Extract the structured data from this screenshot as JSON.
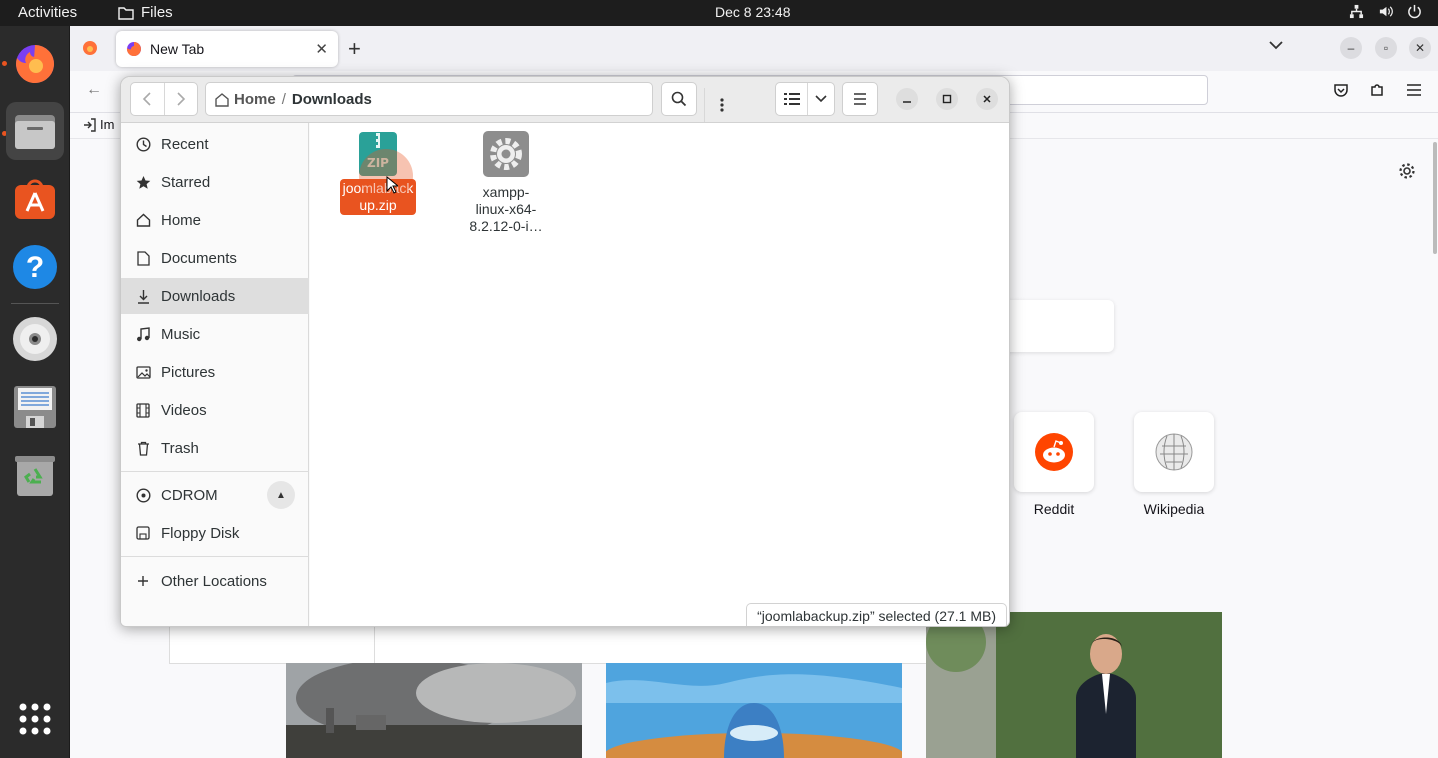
{
  "topbar": {
    "activities": "Activities",
    "app_name": "Files",
    "clock": "Dec 8  23:48"
  },
  "dock": {
    "items": [
      "firefox-icon",
      "files-icon",
      "app-center-icon",
      "help-icon",
      "cdrom-icon",
      "floppy-disk-icon",
      "trash-icon",
      "show-apps-icon"
    ]
  },
  "firefox": {
    "tab_title": "New Tab",
    "bookmark_label": "Im",
    "shortcuts": [
      {
        "label": "Reddit",
        "color": "#ff4500"
      },
      {
        "label": "Wikipedia",
        "color": "#777777"
      }
    ]
  },
  "files": {
    "path": {
      "home": "Home",
      "current": "Downloads"
    },
    "sidebar": {
      "places": [
        {
          "label": "Recent",
          "icon": "clock-icon"
        },
        {
          "label": "Starred",
          "icon": "star-icon"
        },
        {
          "label": "Home",
          "icon": "home-icon"
        },
        {
          "label": "Documents",
          "icon": "document-icon"
        },
        {
          "label": "Downloads",
          "icon": "download-icon",
          "selected": true
        },
        {
          "label": "Music",
          "icon": "music-icon"
        },
        {
          "label": "Pictures",
          "icon": "picture-icon"
        },
        {
          "label": "Videos",
          "icon": "video-icon"
        },
        {
          "label": "Trash",
          "icon": "trash-icon"
        }
      ],
      "devices": [
        {
          "label": "CDROM",
          "icon": "cdrom-icon"
        },
        {
          "label": "Floppy Disk",
          "icon": "floppy-disk-icon"
        }
      ],
      "other": {
        "label": "Other Locations",
        "icon": "plus-icon"
      }
    },
    "items": [
      {
        "name_line1": "joomlaback",
        "name_line2": "up.zip",
        "icon": "zip-archive-icon",
        "selected": true
      },
      {
        "name_line1": "xampp-",
        "name_line2": "linux-x64-",
        "name_line3": "8.2.12-0-i…",
        "icon": "executable-gear-icon",
        "selected": false
      }
    ],
    "status": "“joomlabackup.zip” selected  (27.1 MB)",
    "accent_color": "#e95420"
  }
}
